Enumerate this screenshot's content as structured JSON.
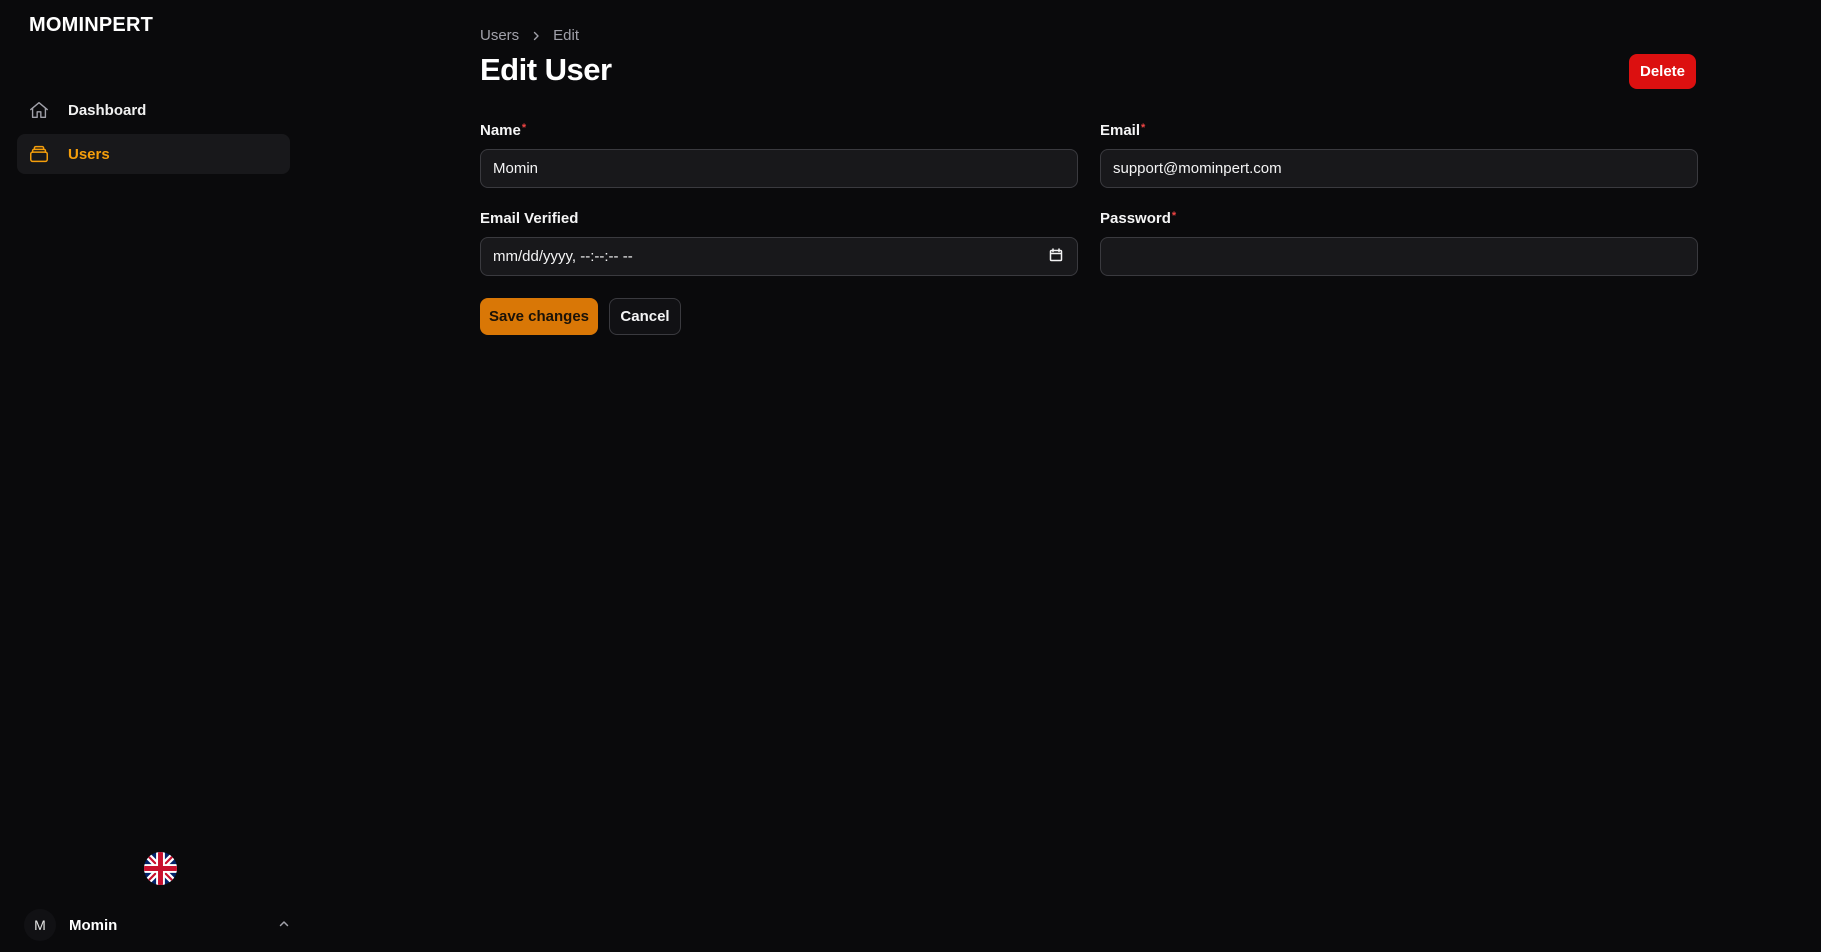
{
  "app": {
    "brand": "MOMINPERT"
  },
  "sidebar": {
    "items": [
      {
        "label": "Dashboard",
        "icon": "home-icon",
        "active": false
      },
      {
        "label": "Users",
        "icon": "rectangle-stack-icon",
        "active": true
      }
    ],
    "language": {
      "icon": "uk-flag-icon"
    },
    "user": {
      "initial": "M",
      "name": "Momin",
      "chevron": "chevron-up-icon"
    }
  },
  "header": {
    "breadcrumb": [
      "Users",
      "Edit"
    ],
    "title": "Edit User",
    "delete_label": "Delete"
  },
  "form": {
    "name": {
      "label": "Name",
      "required_mark": "*",
      "value": "Momin"
    },
    "email": {
      "label": "Email",
      "required_mark": "*",
      "value": "support@mominpert.com"
    },
    "email_verified": {
      "label": "Email Verified",
      "value": "mm/dd/yyyy, --:--:-- --",
      "icon": "calendar-icon"
    },
    "password": {
      "label": "Password",
      "required_mark": "*",
      "value": ""
    },
    "save_label": "Save changes",
    "cancel_label": "Cancel"
  },
  "colors": {
    "background": "#0a0a0c",
    "accent": "#f59e0b",
    "primary_button": "#d97706",
    "danger": "#dc1010"
  }
}
